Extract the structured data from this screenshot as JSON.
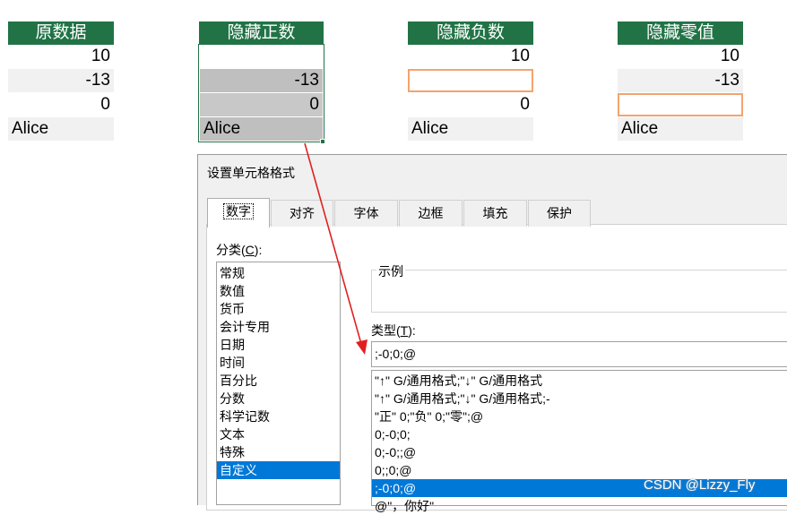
{
  "sheet": {
    "headers": [
      "原数据",
      "隐藏正数",
      "隐藏负数",
      "隐藏零值"
    ],
    "col_original": [
      "10",
      "-13",
      "0",
      "Alice"
    ],
    "col_hide_pos": [
      "",
      "-13",
      "0",
      "Alice"
    ],
    "col_hide_neg": [
      "10",
      "",
      "0",
      "Alice"
    ],
    "col_hide_zero": [
      "10",
      "-13",
      "",
      "Alice"
    ]
  },
  "dialog": {
    "title": "设置单元格格式",
    "tabs": [
      "数字",
      "对齐",
      "字体",
      "边框",
      "填充",
      "保护"
    ],
    "category_label_prefix": "分类(",
    "category_label_key": "C",
    "category_label_suffix": "):",
    "categories": [
      "常规",
      "数值",
      "货币",
      "会计专用",
      "日期",
      "时间",
      "百分比",
      "分数",
      "科学记数",
      "文本",
      "特殊",
      "自定义"
    ],
    "sample_label": "示例",
    "type_label_prefix": "类型(",
    "type_label_key": "T",
    "type_label_suffix": "):",
    "type_value": ";-0;0;@",
    "formats": [
      "\"↑\" G/通用格式;\"↓\" G/通用格式",
      "\"↑\" G/通用格式;\"↓\" G/通用格式;-",
      "\"正\" 0;\"负\" 0;\"零\";@",
      "0;-0;0;",
      "0;-0;;@",
      "0;;0;@",
      ";-0;0;@",
      "@\"，你好\""
    ]
  },
  "watermark": "CSDN @Lizzy_Fly",
  "colors": {
    "header_green": "#217346",
    "selection_blue": "#0078d7",
    "orange_border": "#f4a36e",
    "arrow_red": "#e02020"
  }
}
